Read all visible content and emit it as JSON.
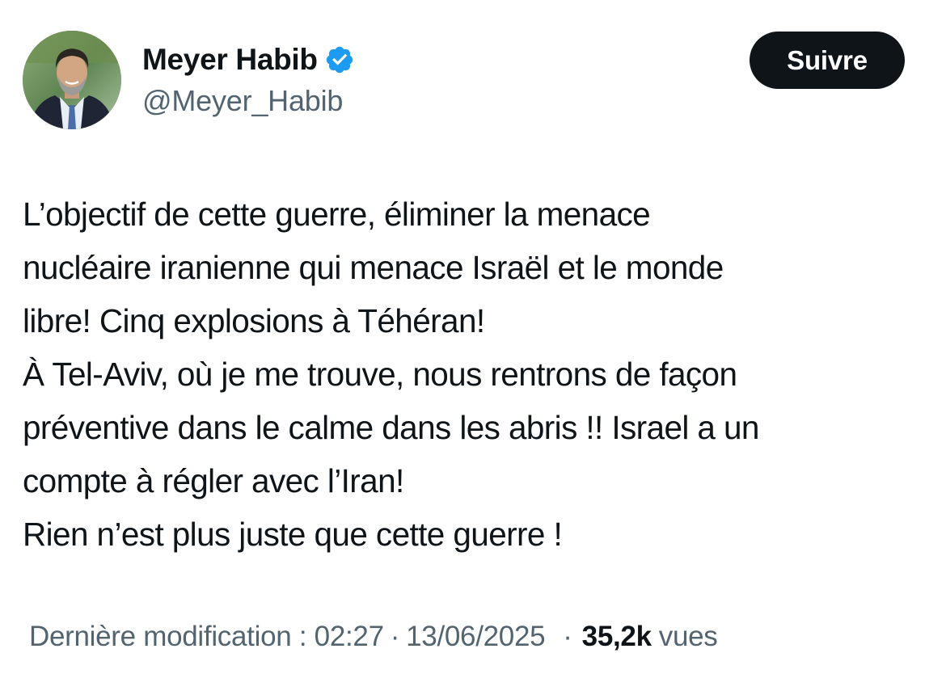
{
  "author": {
    "display_name": "Meyer Habib",
    "handle": "@Meyer_Habib",
    "verified_icon": "verified-badge-icon",
    "verified_color": "#1d9bf0",
    "avatar": "profile-photo"
  },
  "follow_button": {
    "label": "Suivre"
  },
  "tweet": {
    "lines": [
      "L’objectif de cette guerre, éliminer la menace",
      "nucléaire iranienne qui menace Israël et le monde",
      "libre! Cinq explosions à Téhéran!",
      "À Tel-Aviv, où je me trouve, nous rentrons de façon",
      "préventive dans le calme dans les abris !! Israel a un",
      "compte à régler avec l’Iran!",
      "Rien n’est plus juste que cette guerre !"
    ]
  },
  "meta": {
    "edited_label": "Dernière modification : 02:27",
    "separator": "·",
    "date": "13/06/2025",
    "views_count": "35,2k",
    "views_label": "vues"
  },
  "colors": {
    "text_primary": "#0f1419",
    "text_secondary": "#536471",
    "button_bg": "#0f1419",
    "button_text": "#ffffff"
  }
}
